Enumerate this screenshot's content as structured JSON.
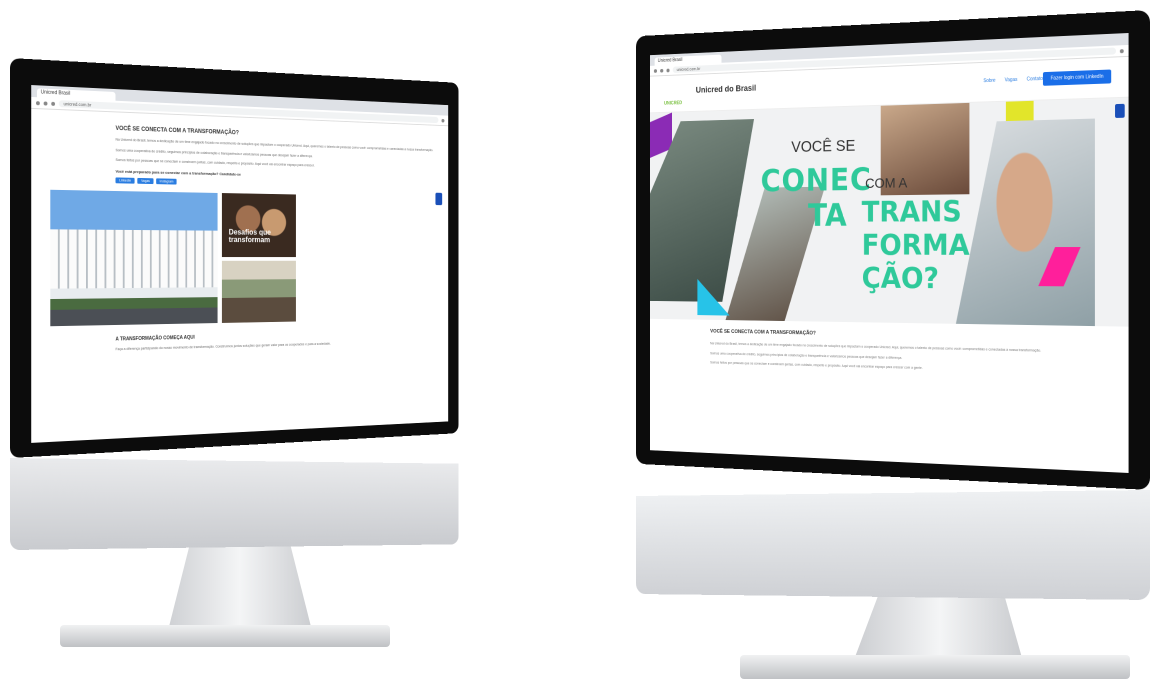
{
  "browser": {
    "left_tab": "Unicred Brasil",
    "right_tab": "Unicred Brasil",
    "left_url": "unicred.com.br",
    "right_url": "unicred.com.br"
  },
  "left_page": {
    "heading": "VOCÊ SE CONECTA COM A TRANSFORMAÇÃO?",
    "paragraphs": [
      "Na Unicred do Brasil, temos a dedicação de um time engajado focado no crescimento de soluções que impactam o cooperado Unicred. Aqui, queremos o talento de pessoas como você: comprometidas e conectadas à nossa transformação.",
      "Somos uma cooperativa de crédito, seguimos princípios de colaboração e transparência e valorizamos pessoas que desejam fazer a diferença.",
      "Somos feitos por pessoas que se conectam e constroem juntas, com cuidado, respeito e propósito. Aqui você vai encontrar espaço para crescer."
    ],
    "quote": "Você está preparado para se conectar com a transformação? Candidate-se",
    "buttons": [
      "LinkedIn",
      "Vagas",
      "Instagram"
    ],
    "photo_caption": "Desafios que transformam",
    "heading2": "A TRANSFORMAÇÃO COMEÇA AQUI",
    "paragraph2": "Faça a diferença participando do nosso movimento de transformação. Construímos juntos soluções que geram valor para os cooperados e para a sociedade."
  },
  "right_page": {
    "site_title": "Unicred do Brasil",
    "logo": "UNICRED",
    "nav": [
      "Sobre",
      "Vagas",
      "Contato"
    ],
    "cta": "Fazer login com LinkedIn",
    "hero": {
      "voce_se": "VOCÊ SE",
      "conec": "CONEC",
      "ta": "TA",
      "com_a": "COM A",
      "trans": "TRANS",
      "forma": "FORMA",
      "cao": "ÇÃO?"
    },
    "heading": "VOCÊ SE CONECTA COM A TRANSFORMAÇÃO?",
    "paragraphs": [
      "Na Unicred do Brasil, temos a dedicação de um time engajado focado no crescimento de soluções que impactam o cooperado Unicred. Aqui, queremos o talento de pessoas como você: comprometidas e conectadas à nossa transformação.",
      "Somos uma cooperativa de crédito, seguimos princípios de colaboração e transparência e valorizamos pessoas que desejam fazer a diferença.",
      "Somos feitos por pessoas que se conectam e constroem juntas, com cuidado, respeito e propósito. Aqui você vai encontrar espaço para crescer com a gente."
    ]
  },
  "colors": {
    "accent_green": "#2fc99a",
    "accent_purple": "#8b2bb5",
    "accent_pink": "#ff1f9b",
    "accent_yellow": "#e2e52a",
    "accent_cyan": "#27c3e8",
    "link_blue": "#2a7de1"
  }
}
